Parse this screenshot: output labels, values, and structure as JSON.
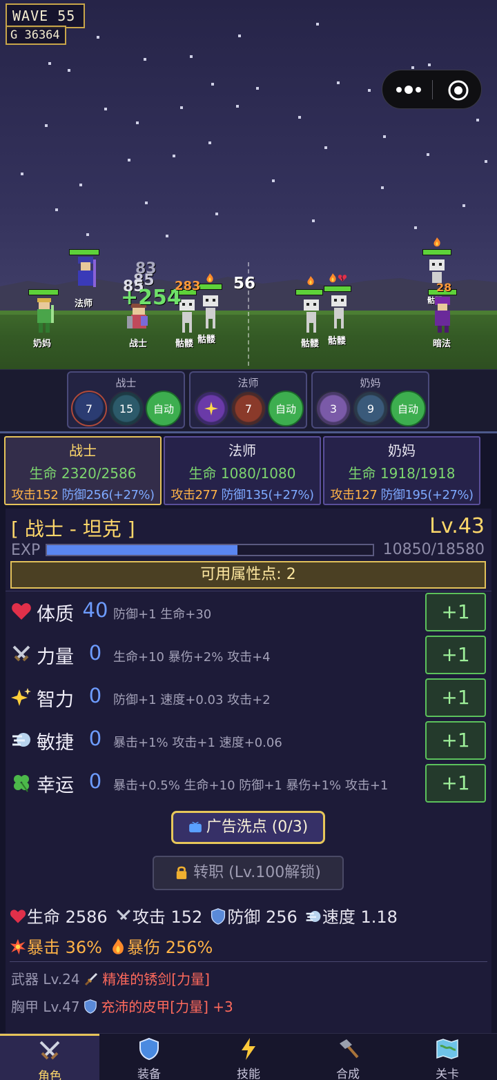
{
  "hud": {
    "wave": "WAVE  55",
    "gold": "G 36364"
  },
  "units": {
    "nurse": "奶妈",
    "mage": "法师",
    "warrior": "战士",
    "skeleton1": "骷髅",
    "skeleton2": "骷髅",
    "skeleton3": "骷髅",
    "skeleton4": "骷髅",
    "skeleton5": "骷髅",
    "dark_mage": "暗法"
  },
  "floats": {
    "heal": "+254",
    "dmg_a": "83",
    "dmg_b": "85",
    "dmg_c": "85",
    "dmg_d": "283",
    "dmg_e": "56",
    "dmg_f": "28"
  },
  "skill_panels": [
    {
      "title": "战士",
      "s1": "7",
      "s2": "15",
      "auto": "自动"
    },
    {
      "title": "法师",
      "s1": "",
      "s2": "7",
      "auto": "自动"
    },
    {
      "title": "奶妈",
      "s1": "3",
      "s2": "9",
      "auto": "自动"
    }
  ],
  "heroes": [
    {
      "name": "战士",
      "life": "生命 2320/2586",
      "atk": "攻击152",
      "def": "防御256(+27%)"
    },
    {
      "name": "法师",
      "life": "生命 1080/1080",
      "atk": "攻击277",
      "def": "防御135(+27%)"
    },
    {
      "name": "奶妈",
      "life": "生命 1918/1918",
      "atk": "攻击127",
      "def": "防御195(+27%)"
    }
  ],
  "detail": {
    "class_title": "[ 战士 - 坦克 ]",
    "level": "Lv.43",
    "exp_label": "EXP",
    "exp_text": "10850/18580",
    "exp_fraction": 0.584,
    "points": "可用属性点: 2",
    "attrs": [
      {
        "name": "体质",
        "value": "40",
        "desc": "防御+1 生命+30",
        "btn": "+1",
        "icon": "heart-icon"
      },
      {
        "name": "力量",
        "value": "0",
        "desc": "生命+10 暴伤+2% 攻击+4",
        "btn": "+1",
        "icon": "swords-icon"
      },
      {
        "name": "智力",
        "value": "0",
        "desc": "防御+1 速度+0.03 攻击+2",
        "btn": "+1",
        "icon": "sparkle-icon"
      },
      {
        "name": "敏捷",
        "value": "0",
        "desc": "暴击+1% 攻击+1 速度+0.06",
        "btn": "+1",
        "icon": "wind-icon"
      },
      {
        "name": "幸运",
        "value": "0",
        "desc": "暴击+0.5% 生命+10 防御+1 暴伤+1% 攻击+1",
        "btn": "+1",
        "icon": "clover-icon"
      }
    ],
    "ad_button": "广告洗点 (0/3)",
    "job_button": "转职 (Lv.100解锁)",
    "stats": {
      "life": "生命 2586",
      "atk": "攻击 152",
      "def": "防御 256",
      "speed": "速度 1.18",
      "crit": "暴击 36%",
      "crit_dmg": "暴伤 256%"
    },
    "equipment": [
      {
        "slot": "武器",
        "lv": "Lv.24",
        "name": "精准的锈剑[力量]"
      },
      {
        "slot": "胸甲",
        "lv": "Lv.47",
        "name": "充沛的皮甲[力量] +3"
      }
    ]
  },
  "nav": [
    {
      "label": "角色",
      "icon": "swords-icon",
      "active": true
    },
    {
      "label": "装备",
      "icon": "shield-icon"
    },
    {
      "label": "技能",
      "icon": "lightning-icon"
    },
    {
      "label": "合成",
      "icon": "hammer-icon"
    },
    {
      "label": "关卡",
      "icon": "map-icon"
    }
  ],
  "colors": {
    "accent_gold": "#e6c45a",
    "life_green": "#7dd66f",
    "atk_orange": "#ffb347",
    "def_blue": "#7ea9ff",
    "crit_red": "#ff6a5c"
  }
}
